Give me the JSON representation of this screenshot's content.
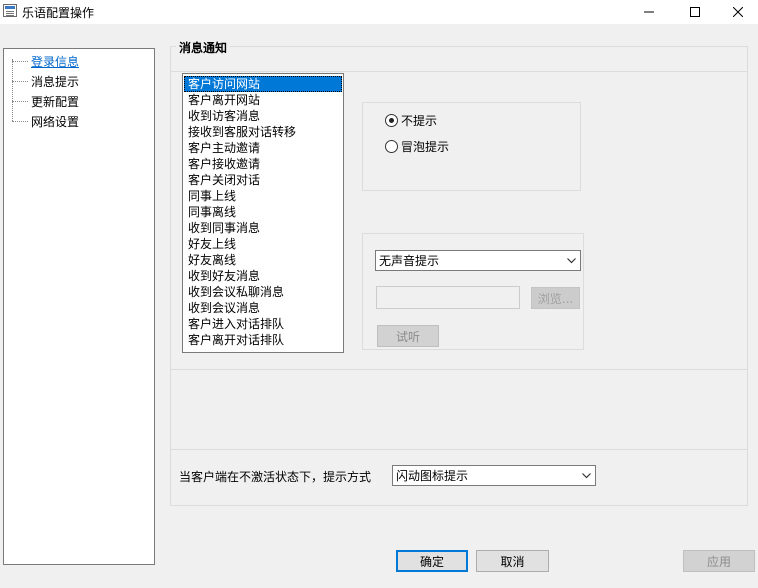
{
  "window": {
    "title": "乐语配置操作",
    "controls": {
      "minimize": "minimize-icon",
      "maximize": "maximize-icon",
      "close": "close-icon"
    }
  },
  "tree": {
    "items": [
      {
        "label": "登录信息",
        "selected": true
      },
      {
        "label": "消息提示",
        "selected": false
      },
      {
        "label": "更新配置",
        "selected": false
      },
      {
        "label": "网络设置",
        "selected": false
      }
    ]
  },
  "group": {
    "title": "消息通知"
  },
  "events": {
    "selected_index": 0,
    "items": [
      "客户访问网站",
      "客户离开网站",
      "收到访客消息",
      "接收到客服对话转移",
      "客户主动邀请",
      "客户接收邀请",
      "客户关闭对话",
      "同事上线",
      "同事离线",
      "收到同事消息",
      "好友上线",
      "好友离线",
      "收到好友消息",
      "收到会议私聊消息",
      "收到会议消息",
      "客户进入对话排队",
      "客户离开对话排队"
    ]
  },
  "notify": {
    "options": [
      {
        "label": "不提示",
        "checked": true
      },
      {
        "label": "冒泡提示",
        "checked": false
      }
    ]
  },
  "sound": {
    "selected": "无声音提示",
    "file_value": "",
    "browse_label": "浏览...",
    "listen_label": "试听"
  },
  "inactive": {
    "label": "当客户端在不激活状态下，提示方式",
    "selected": "闪动图标提示"
  },
  "footer": {
    "ok_label": "确定",
    "cancel_label": "取消",
    "apply_label": "应用"
  },
  "colors": {
    "selection": "#0078d7",
    "link": "#0066cc",
    "background": "#f0f0f0"
  }
}
